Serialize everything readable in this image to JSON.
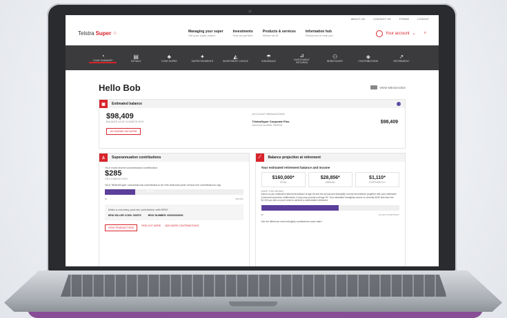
{
  "topbar": [
    "ABOUT US",
    "CONTACT US",
    "FORMS",
    "LOGOUT"
  ],
  "brand": {
    "name_part1": "Telstra",
    "name_part2": "Super"
  },
  "header_nav": [
    {
      "title": "Managing your super",
      "sub": "Get your super sorted"
    },
    {
      "title": "Investments",
      "sub": "How we perform"
    },
    {
      "title": "Products & services",
      "sub": "Where we fit"
    },
    {
      "title": "Information hub",
      "sub": "Resources to help you"
    }
  ],
  "account": {
    "label": "Your account"
  },
  "icon_nav": [
    {
      "label": "YOUR SUMMARY",
      "icon": "gauge-icon"
    },
    {
      "label": "DETAILS",
      "icon": "details-icon"
    },
    {
      "label": "YOUR SUPER",
      "icon": "piggy-icon"
    },
    {
      "label": "SUPER PAYMENTS",
      "icon": "payments-icon"
    },
    {
      "label": "INVESTMENT CHOICE",
      "icon": "chart-icon"
    },
    {
      "label": "INSURANCE",
      "icon": "umbrella-icon"
    },
    {
      "label": "INVESTMENT RETURNS",
      "icon": "returns-icon"
    },
    {
      "label": "BENEFICIARY",
      "icon": "people-icon"
    },
    {
      "label": "CONTRIBUTIONS",
      "icon": "coins-icon"
    },
    {
      "label": "RETIREMENT",
      "icon": "trend-icon"
    }
  ],
  "page": {
    "title": "Hello Bob",
    "messages_label": "VIEW MESSAGES"
  },
  "estimated": {
    "heading": "Estimated balance",
    "amount": "$98,409",
    "as_at": "BALANCE AS AT 14 MARCH 2019",
    "button": "AS SHOWN ON SUPER",
    "breakdown_heading": "ACCOUNT BREAKDOWN",
    "account_name": "TelstraSuper Corporate Plus",
    "account_number": "Account number 000000",
    "account_amount": "$98,409"
  },
  "contributions": {
    "heading": "Superannuation contributions",
    "intro": "Your most recent concessional contribution",
    "amount": "$285",
    "date": "ON 01 MARCH 2019",
    "note": "Your TelstraSuper concessional contributions for this financial year versus the contributions cap",
    "bar_value": "$5,424",
    "bar_fraction": 0.22,
    "range_min": "$0",
    "range_max": "$25,000",
    "bpay_note": "Make a voluntary post-tax contribution with BPAY",
    "biller_code": "BPAY BILLER CODE: 500579",
    "bpay_ref": "BPAY NUMBER: 000000000000",
    "link1": "VIEW TRANSACTIONS",
    "link2": "FIND OUT MORE",
    "link3": "ADD MORE CONTRIBUTIONS"
  },
  "projection": {
    "heading": "Balance projection at retirement",
    "sub": "Your estimated retirement balance and income",
    "boxes": [
      {
        "value": "$160,000*",
        "label": "TOTAL"
      },
      {
        "value": "$28,856*",
        "label": "ANNUAL"
      },
      {
        "value": "$1,110*",
        "label": "FORTNIGHTLY"
      }
    ],
    "explain_heading": "WHAT THIS MEANS",
    "explain": "Above is your estimated retirement balance at age 65 and the annual and fortnightly income this balance (together with your estimated Government pension entitlements, if any) may provide until age 90. Your estimated fortnightly income is currently $130 less than the $1,240 you told us you'd need to achieve a comfortable retirement.",
    "bar_fraction": 0.56,
    "bar_min": "$0",
    "bar_max": "$1,240 A FORTNIGHT",
    "footnote": "See the difference extra fortnightly contributions could make *"
  }
}
